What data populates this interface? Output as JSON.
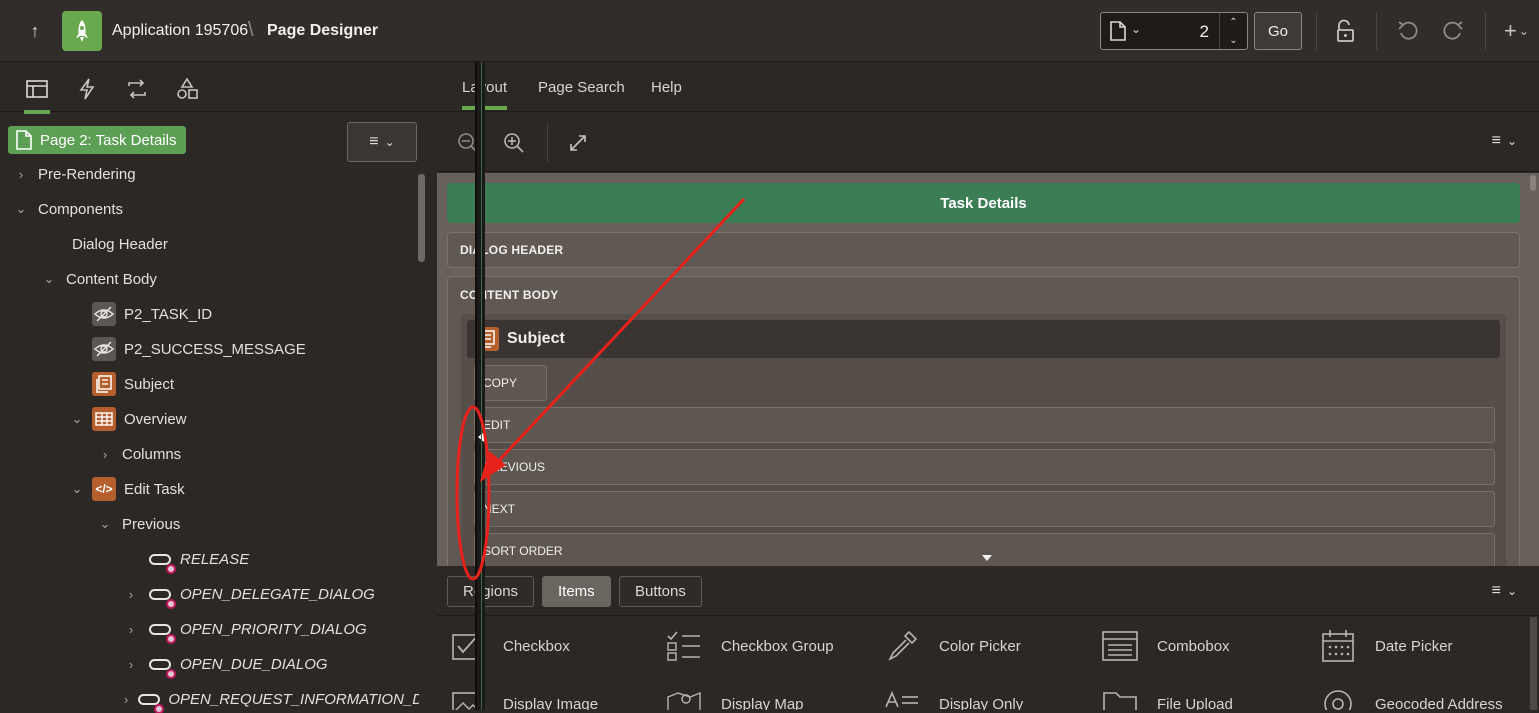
{
  "header": {
    "app_name": "Application 195706",
    "separator": "\\",
    "page_designer": "Page Designer",
    "page_number": "2",
    "go_label": "Go"
  },
  "left": {
    "page_badge": "Page 2: Task Details",
    "tree": [
      {
        "label": "Pre-Rendering",
        "twisty": "collapsed"
      },
      {
        "label": "Components",
        "twisty": "expanded"
      },
      {
        "label": "Dialog Header",
        "twisty": "none"
      },
      {
        "label": "Content Body",
        "twisty": "expanded"
      },
      {
        "label": "P2_TASK_ID",
        "icon": "hidden-item-icon"
      },
      {
        "label": "P2_SUCCESS_MESSAGE",
        "icon": "hidden-item-icon"
      },
      {
        "label": "Subject",
        "icon": "region-icon"
      },
      {
        "label": "Overview",
        "icon": "table-icon",
        "twisty": "expanded"
      },
      {
        "label": "Columns",
        "twisty": "collapsed"
      },
      {
        "label": "Edit Task",
        "icon": "code-icon",
        "twisty": "expanded"
      },
      {
        "label": "Previous",
        "twisty": "expanded"
      },
      {
        "label": "RELEASE",
        "icon": "button-icon"
      },
      {
        "label": "OPEN_DELEGATE_DIALOG",
        "icon": "button-icon",
        "twisty": "collapsed"
      },
      {
        "label": "OPEN_PRIORITY_DIALOG",
        "icon": "button-icon",
        "twisty": "collapsed"
      },
      {
        "label": "OPEN_DUE_DIALOG",
        "icon": "button-icon",
        "twisty": "collapsed"
      },
      {
        "label": "OPEN_REQUEST_INFORMATION_DI",
        "icon": "button-icon",
        "twisty": "collapsed"
      }
    ]
  },
  "right": {
    "tabs": [
      "Layout",
      "Page Search",
      "Help"
    ],
    "layout": {
      "title": "Task Details",
      "dialog_header": "DIALOG HEADER",
      "content_body": "CONTENT BODY",
      "subject": "Subject",
      "slots": [
        "COPY",
        "EDIT",
        "PREVIOUS",
        "NEXT",
        "SORT ORDER"
      ]
    },
    "gallery_tabs": [
      "Regions",
      "Items",
      "Buttons"
    ],
    "gallery_items": [
      "Checkbox",
      "Checkbox Group",
      "Color Picker",
      "Combobox",
      "Date Picker",
      "Display Image",
      "Display Map",
      "Display Only",
      "File Upload",
      "Geocoded Address"
    ]
  },
  "colors": {
    "accent_green": "#6aa84f",
    "title_green": "#3b7d55",
    "annotation_red": "#e8221b"
  }
}
